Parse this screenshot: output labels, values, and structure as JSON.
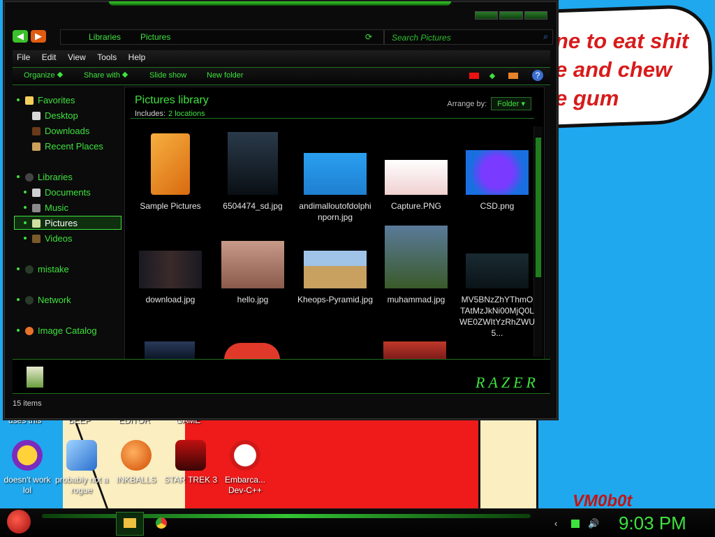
{
  "wallpaper": {
    "speech_text": "ne to eat shit\ne and chew\ne gum",
    "signature": "VM0b0t"
  },
  "desktop": {
    "partial_labels": [
      "uses this",
      "BEEP",
      "EDITOR",
      "GAME"
    ],
    "icons": [
      {
        "label": "doesn't work lol",
        "icon": "yahoo-messenger-icon"
      },
      {
        "label": "probably not a rogue",
        "icon": "gears-installer-icon"
      },
      {
        "label": "INKBALLS",
        "icon": "inkball-icon"
      },
      {
        "label": "STAR TREK 3",
        "icon": "star-wars-icon"
      },
      {
        "label": "Embarca... Dev-C++",
        "icon": "dev-cpp-icon"
      }
    ]
  },
  "window": {
    "address": {
      "segment1": "Libraries",
      "segment2": "Pictures"
    },
    "search": {
      "placeholder": "Search Pictures"
    },
    "menu": [
      "File",
      "Edit",
      "View",
      "Tools",
      "Help"
    ],
    "toolbar": {
      "organize": "Organize",
      "share": "Share with",
      "slideshow": "Slide show",
      "newfolder": "New folder",
      "help": "?"
    },
    "nav": {
      "favorites": "Favorites",
      "desktop": "Desktop",
      "downloads": "Downloads",
      "recent": "Recent Places",
      "libraries": "Libraries",
      "documents": "Documents",
      "music": "Music",
      "pictures": "Pictures",
      "videos": "Videos",
      "mistake": "mistake",
      "network": "Network",
      "catalog": "Image Catalog"
    },
    "library": {
      "title": "Pictures library",
      "includes_label": "Includes:",
      "includes_value": "2 locations",
      "arrange_label": "Arrange by:",
      "arrange_value": "Folder"
    },
    "files": [
      {
        "name": "Sample Pictures",
        "icon": "folder-icon"
      },
      {
        "name": "6504474_sd.jpg",
        "icon": "image-thumbnail"
      },
      {
        "name": "andimalloutofdolphinporn.jpg",
        "icon": "image-thumbnail"
      },
      {
        "name": "Capture.PNG",
        "icon": "image-thumbnail"
      },
      {
        "name": "CSD.png",
        "icon": "image-thumbnail"
      },
      {
        "name": "download.jpg",
        "icon": "image-thumbnail"
      },
      {
        "name": "hello.jpg",
        "icon": "image-thumbnail"
      },
      {
        "name": "Kheops-Pyramid.jpg",
        "icon": "image-thumbnail"
      },
      {
        "name": "muhammad.jpg",
        "icon": "image-thumbnail"
      },
      {
        "name": "MV5BNzZhYThmOTAtMzJkNi00MjQ0LWE0ZWItYzRhZWU5...",
        "icon": "image-thumbnail"
      }
    ],
    "branding": "RAZER",
    "status": "15 items"
  },
  "taskbar": {
    "time": "9:03 PM"
  },
  "colors": {
    "accent": "#3ee23e",
    "window_bg": "#0b0b0b",
    "wallpaper": "#1fa8ee"
  }
}
